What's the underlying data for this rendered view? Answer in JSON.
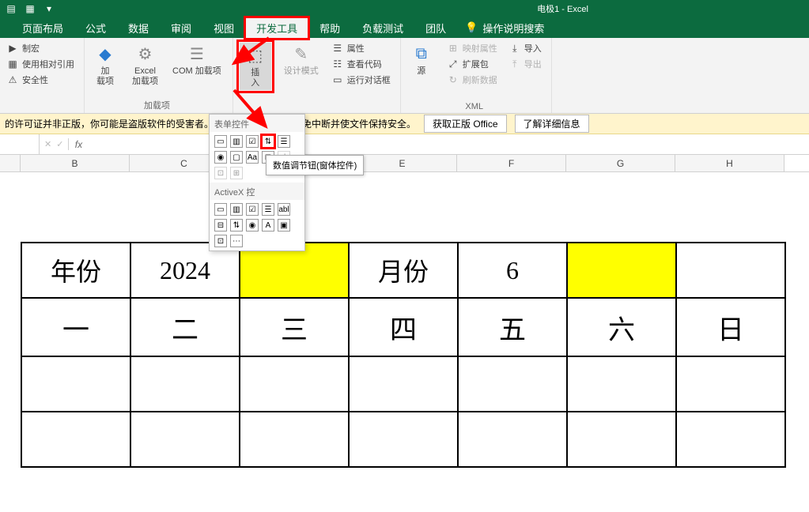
{
  "title": "电极1 - Excel",
  "tabs": {
    "page_layout": "页面布局",
    "formulas": "公式",
    "data": "数据",
    "review": "审阅",
    "view": "视图",
    "developer": "开发工具",
    "help": "帮助",
    "loadtest": "负载测试",
    "team": "团队",
    "search": "操作说明搜索"
  },
  "ribbon": {
    "group1": {
      "r1": "制宏",
      "r2": "使用相对引用",
      "r3": "安全性"
    },
    "addins": {
      "addin": "加\n载项",
      "excel_addin": "Excel\n加载项",
      "com_addin": "COM 加载项",
      "label": "加载项"
    },
    "controls": {
      "insert": "插\n入",
      "design": "设计模式",
      "props": "属性",
      "view_code": "查看代码",
      "run_dialog": "运行对话框"
    },
    "xml": {
      "source": "源",
      "map_props": "映射属性",
      "expand_pack": "扩展包",
      "refresh": "刷新数据",
      "import": "导入",
      "export": "导出",
      "label": "XML"
    }
  },
  "dropdown": {
    "form_label": "表单控件",
    "activex_label": "ActiveX 控",
    "tooltip": "数值调节钮(窗体控件)"
  },
  "msgbar": {
    "text": "的许可证并非正版，你可能是盗版软件的受害者。",
    "text2": "避免中断并使文件保持安全。",
    "btn1": "获取正版 Office",
    "btn2": "了解详细信息"
  },
  "fbar": {
    "fx": "fx"
  },
  "columns": [
    "B",
    "C",
    "",
    "E",
    "F",
    "G",
    "H"
  ],
  "calendar": {
    "year_label": "年份",
    "year_value": "2024",
    "month_label": "月份",
    "month_value": "6",
    "weekdays": [
      "一",
      "二",
      "三",
      "四",
      "五",
      "六",
      "日"
    ]
  }
}
